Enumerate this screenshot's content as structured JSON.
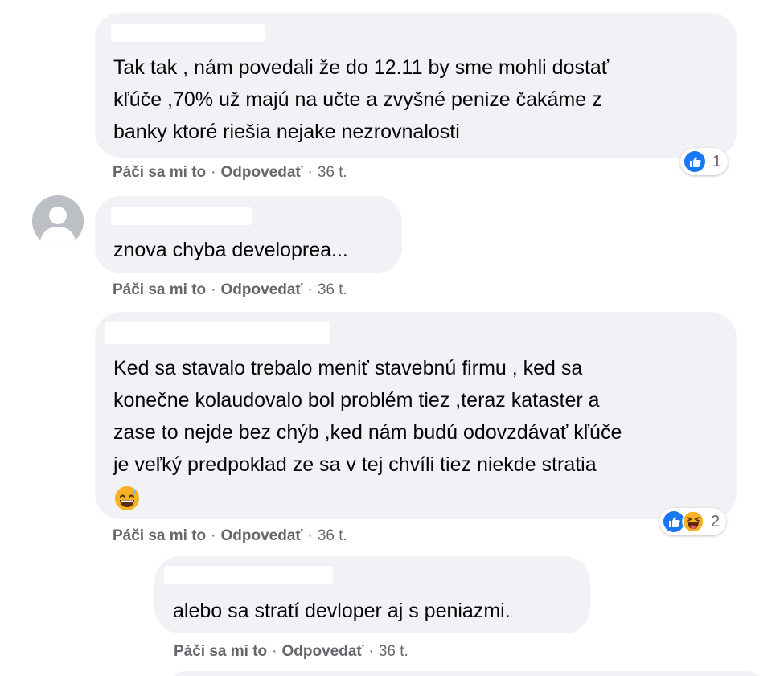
{
  "comments": [
    {
      "text": "Tak tak , nám povedali že do 12.11 by sme mohli dostať\nkľúče ,70% už majú na učte a zvyšné penize čakáme z\nbanky ktoré riešia nejake nezrovnalosti",
      "actions": {
        "like": "Páči sa mi to",
        "reply": "Odpovedať",
        "time": "36 t."
      },
      "reactions": {
        "count": "1",
        "icons": [
          "like-icon"
        ]
      }
    },
    {
      "text": "znova chyba developrea...",
      "actions": {
        "like": "Páči sa mi to",
        "reply": "Odpovedať",
        "time": "36 t."
      }
    },
    {
      "text": "Ked sa stavalo trebalo meniť stavebnú firmu , ked sa\nkonečne kolaudovalo bol problém tiez ,teraz kataster a\nzase to nejde bez chýb ,ked nám budú odovzdávať kľúče\nje veľký predpoklad ze sa v tej chvíli tiez niekde stratia",
      "emoji": "grinning-sweat-icon",
      "actions": {
        "like": "Páči sa mi to",
        "reply": "Odpovedať",
        "time": "36 t."
      },
      "reactions": {
        "count": "2",
        "icons": [
          "like-icon",
          "haha-icon"
        ]
      }
    },
    {
      "text": "alebo sa stratí devloper aj s peniazmi.",
      "actions": {
        "like": "Páči sa mi to",
        "reply": "Odpovedať",
        "time": "36 t."
      }
    }
  ],
  "colors": {
    "bubble": "#f0f2f5",
    "meta_text": "#65676b",
    "like_blue": "#1877f2",
    "haha_yellow": "#f7b125"
  }
}
